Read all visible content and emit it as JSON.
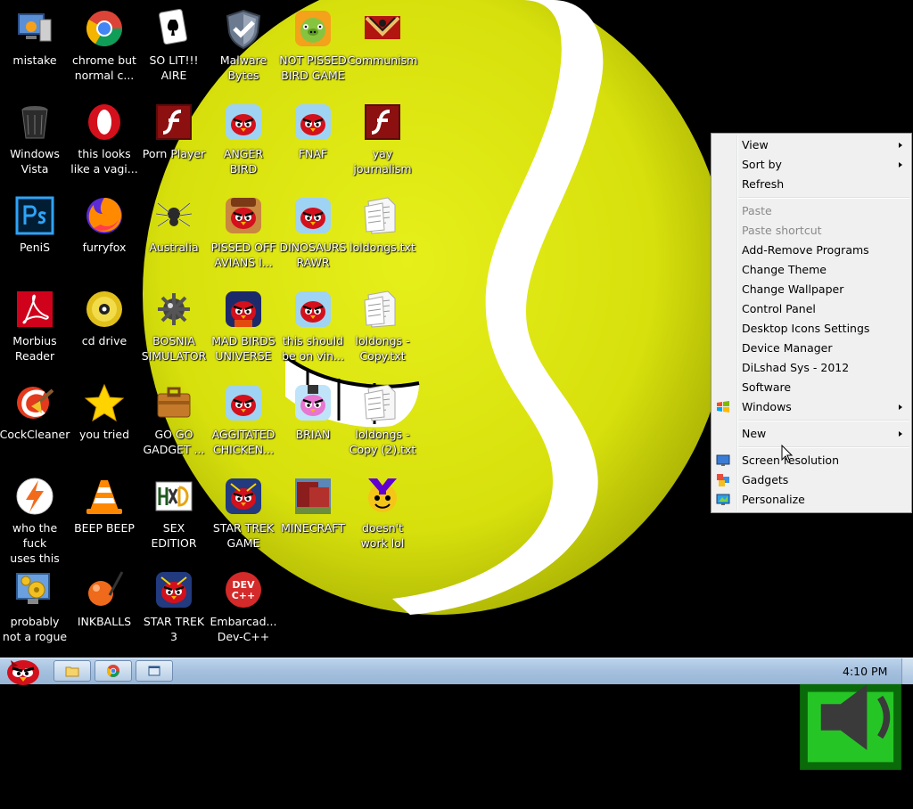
{
  "desktop": {
    "icons": [
      {
        "id": "mistake",
        "label": "mistake",
        "icon": "computer-icon"
      },
      {
        "id": "chrome",
        "label": "chrome but\nnormal c...",
        "icon": "chrome-icon"
      },
      {
        "id": "solitaire",
        "label": "SO LIT!!!\nAIRE",
        "icon": "playing-card-icon"
      },
      {
        "id": "malwarebytes",
        "label": "Malware\nBytes",
        "icon": "shield-icon"
      },
      {
        "id": "bad-piggies",
        "label": "NOT PISSED\nBIRD GAME",
        "icon": "green-pig-icon"
      },
      {
        "id": "papers-please",
        "label": "Communism",
        "icon": "emblem-icon"
      },
      {
        "id": "windows-vista",
        "label": "Windows\nVista",
        "icon": "trash-bin-icon"
      },
      {
        "id": "opera",
        "label": "this looks\nlike a vagi...",
        "icon": "opera-icon"
      },
      {
        "id": "flash-player",
        "label": "Porn Player",
        "icon": "flash-icon"
      },
      {
        "id": "anger-bird",
        "label": "ANGER\nBIRD",
        "icon": "angry-bird-icon"
      },
      {
        "id": "fnaf",
        "label": "FNAF",
        "icon": "angry-bird-icon"
      },
      {
        "id": "yay-journalism",
        "label": "yay\njournalism",
        "icon": "flash-icon"
      },
      {
        "id": "photoshop",
        "label": "PeniS",
        "icon": "photoshop-icon"
      },
      {
        "id": "firefox",
        "label": "furryfox",
        "icon": "firefox-icon"
      },
      {
        "id": "spider",
        "label": "Australia",
        "icon": "spider-icon"
      },
      {
        "id": "pissed-off-avians",
        "label": "PISSED OFF\nAVIANS I...",
        "icon": "angry-bird-seasons-icon"
      },
      {
        "id": "dinosaurs-rawr",
        "label": "DINOSAURS\nRAWR",
        "icon": "angry-bird-icon"
      },
      {
        "id": "loldongs",
        "label": "loldongs.txt",
        "icon": "text-file-icon"
      },
      {
        "id": "acrobat",
        "label": "Morbius\nReader",
        "icon": "acrobat-icon"
      },
      {
        "id": "cd-drive",
        "label": "cd drive",
        "icon": "cd-icon"
      },
      {
        "id": "minesweeper",
        "label": "BOSNIA\nSIMULATOR",
        "icon": "mine-icon"
      },
      {
        "id": "mad-birds",
        "label": "MAD BIRDS\nUNIVERSE",
        "icon": "angry-bird-space-icon"
      },
      {
        "id": "this-should",
        "label": "this should\nbe on vin...",
        "icon": "angry-bird-icon"
      },
      {
        "id": "loldongs-copy",
        "label": "loldongs -\nCopy.txt",
        "icon": "text-file-icon"
      },
      {
        "id": "ccleaner",
        "label": "CockCleaner",
        "icon": "ccleaner-icon"
      },
      {
        "id": "you-tried",
        "label": "you tried",
        "icon": "star-icon"
      },
      {
        "id": "go-go-gadget",
        "label": "GO GO\nGADGET ...",
        "icon": "briefcase-icon"
      },
      {
        "id": "aggitated-chicken",
        "label": "AGGITATED\nCHICKEN...",
        "icon": "angry-bird-icon"
      },
      {
        "id": "brian",
        "label": "BRIAN",
        "icon": "angry-bird-stella-icon"
      },
      {
        "id": "loldongs-copy-2",
        "label": "loldongs -\nCopy (2).txt",
        "icon": "text-file-icon"
      },
      {
        "id": "who-uses-this",
        "label": "who the fuck\nuses this",
        "icon": "lightning-icon"
      },
      {
        "id": "vlc",
        "label": "BEEP BEEP",
        "icon": "vlc-cone-icon"
      },
      {
        "id": "sex-editior",
        "label": "SEX\nEDITIOR",
        "icon": "hxd-icon"
      },
      {
        "id": "star-trek-game",
        "label": "STAR TREK\nGAME",
        "icon": "angry-bird-starwars-icon"
      },
      {
        "id": "minecraft",
        "label": "MINECRAFT",
        "icon": "minecraft-icon"
      },
      {
        "id": "yahoo",
        "label": "doesn't\nwork lol",
        "icon": "yahoo-icon"
      },
      {
        "id": "probably-not-rogue",
        "label": "probably\nnot a rogue",
        "icon": "monitor-gears-icon"
      },
      {
        "id": "inkballs",
        "label": "INKBALLS",
        "icon": "inkball-icon"
      },
      {
        "id": "star-trek-3",
        "label": "STAR TREK\n3",
        "icon": "angry-bird-starwars-icon"
      },
      {
        "id": "dev-cpp",
        "label": "Embarcad...\nDev-C++",
        "icon": "devcpp-icon"
      }
    ]
  },
  "context_menu": {
    "items": [
      {
        "label": "View",
        "submenu": true,
        "disabled": false
      },
      {
        "label": "Sort by",
        "submenu": true,
        "disabled": false
      },
      {
        "label": "Refresh",
        "submenu": false,
        "disabled": false
      },
      {
        "sep": true
      },
      {
        "label": "Paste",
        "submenu": false,
        "disabled": true
      },
      {
        "label": "Paste shortcut",
        "submenu": false,
        "disabled": true
      },
      {
        "label": "Add-Remove Programs",
        "submenu": false,
        "disabled": false
      },
      {
        "label": "Change Theme",
        "submenu": false,
        "disabled": false
      },
      {
        "label": "Change Wallpaper",
        "submenu": false,
        "disabled": false
      },
      {
        "label": "Control Panel",
        "submenu": false,
        "disabled": false
      },
      {
        "label": "Desktop Icons Settings",
        "submenu": false,
        "disabled": false
      },
      {
        "label": "Device Manager",
        "submenu": false,
        "disabled": false
      },
      {
        "label": "DiLshad Sys - 2012",
        "submenu": false,
        "disabled": false
      },
      {
        "label": "Software",
        "submenu": false,
        "disabled": false
      },
      {
        "label": "Windows",
        "submenu": true,
        "disabled": false,
        "icon": "windows-flag-icon"
      },
      {
        "sep": true
      },
      {
        "label": "New",
        "submenu": true,
        "disabled": false
      },
      {
        "sep": true
      },
      {
        "label": "Screen resolution",
        "submenu": false,
        "disabled": false,
        "icon": "screen-resolution-icon"
      },
      {
        "label": "Gadgets",
        "submenu": false,
        "disabled": false,
        "icon": "gadgets-icon"
      },
      {
        "label": "Personalize",
        "submenu": false,
        "disabled": false,
        "icon": "personalize-icon"
      }
    ]
  },
  "taskbar": {
    "start_icon": "angry-bird-start-icon",
    "pinned": [
      {
        "id": "explorer",
        "icon": "folder-icon"
      },
      {
        "id": "chrome",
        "icon": "chrome-icon"
      },
      {
        "id": "show-windows",
        "icon": "window-switch-icon"
      }
    ],
    "tray": {
      "icons": [
        "show-hidden-icons-icon",
        "battery-icon",
        "volume-icon"
      ],
      "clock": "4:10 PM"
    }
  },
  "colors": {
    "tennis_ball": "#d9e40a",
    "seam": "#ffffff",
    "menu_bg": "#f0f0f0",
    "taskbar": "#a9c3df"
  }
}
